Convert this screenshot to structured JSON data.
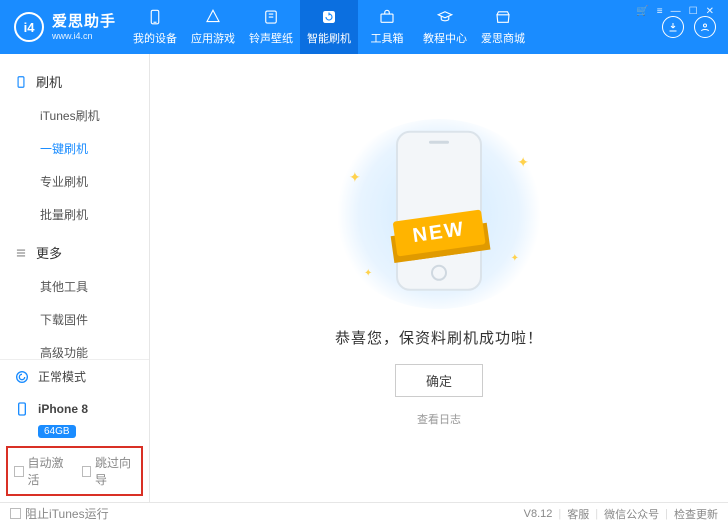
{
  "app": {
    "name_cn": "爱思助手",
    "name_en": "www.i4.cn",
    "logo_text": "i4"
  },
  "topnav": {
    "items": [
      {
        "label": "我的设备"
      },
      {
        "label": "应用游戏"
      },
      {
        "label": "铃声壁纸"
      },
      {
        "label": "智能刷机"
      },
      {
        "label": "工具箱"
      },
      {
        "label": "教程中心"
      },
      {
        "label": "爱思商城"
      }
    ],
    "active_index": 3
  },
  "sidebar": {
    "group_flash": {
      "title": "刷机",
      "items": [
        {
          "label": "iTunes刷机"
        },
        {
          "label": "一键刷机"
        },
        {
          "label": "专业刷机"
        },
        {
          "label": "批量刷机"
        }
      ],
      "active_index": 1
    },
    "group_more": {
      "title": "更多",
      "items": [
        {
          "label": "其他工具"
        },
        {
          "label": "下载固件"
        },
        {
          "label": "高级功能"
        }
      ]
    },
    "mode_label": "正常模式",
    "device_name": "iPhone 8",
    "device_storage": "64GB",
    "opt_auto_activate": "自动激活",
    "opt_skip_wizard": "跳过向导"
  },
  "main": {
    "ribbon_text": "NEW",
    "success_msg": "恭喜您，保资料刷机成功啦！",
    "ok_label": "确定",
    "view_log_label": "查看日志"
  },
  "statusbar": {
    "block_itunes": "阻止iTunes运行",
    "version": "V8.12",
    "support": "客服",
    "wechat": "微信公众号",
    "check_update": "检查更新"
  }
}
